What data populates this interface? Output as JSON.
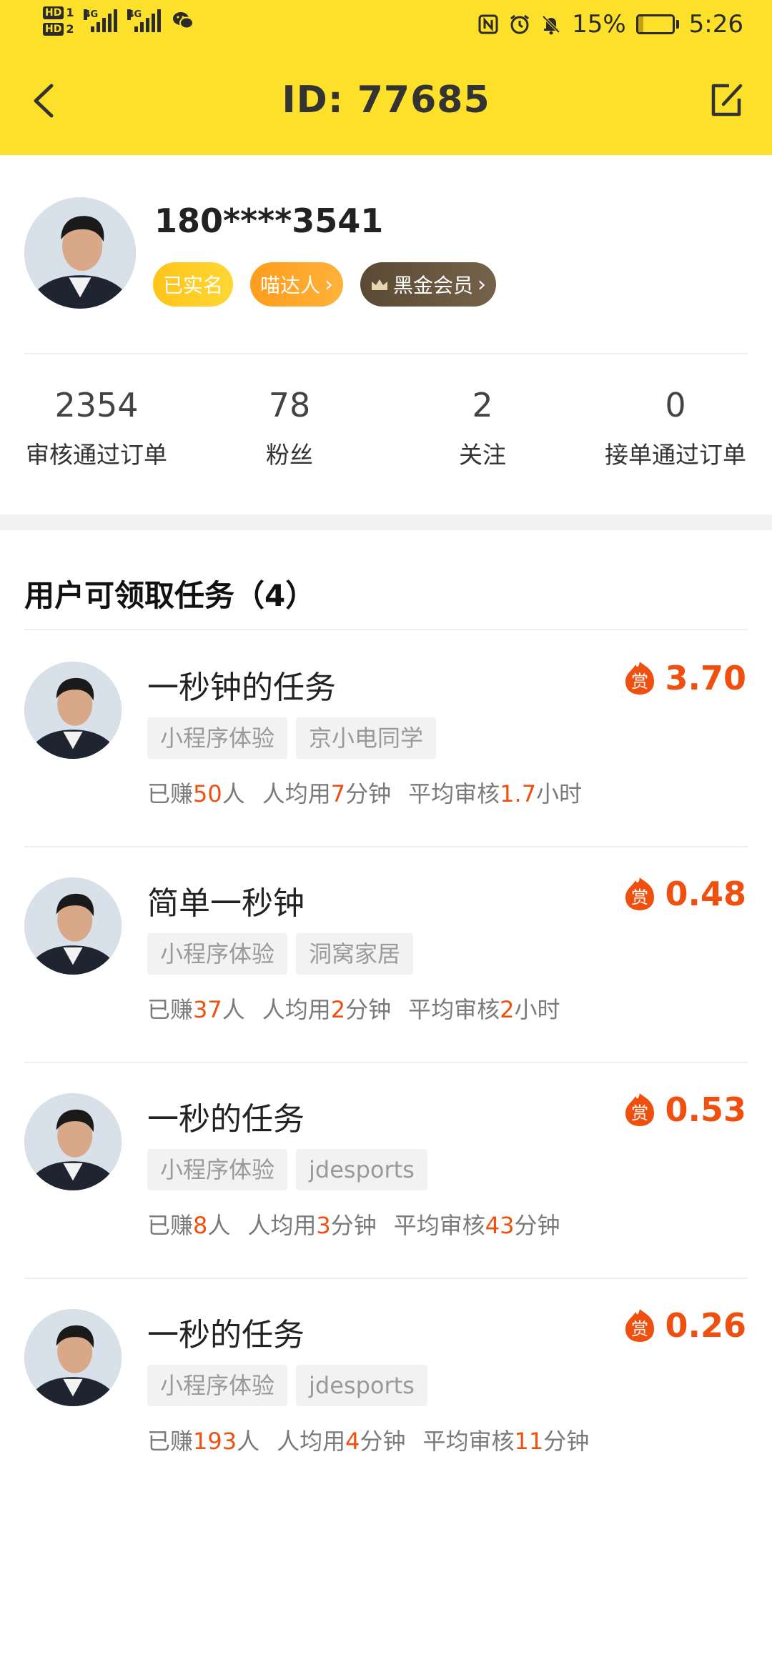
{
  "status_bar": {
    "sim1": "HD",
    "sim1_num": "1",
    "sim2": "HD",
    "sim2_num": "2",
    "net1": "4G",
    "net2": "4G",
    "battery_percent_text": "15%",
    "battery_level": 0.15,
    "time": "5:26"
  },
  "header": {
    "title": "ID:  77685"
  },
  "profile": {
    "phone": "180****3541",
    "badges": {
      "real_name": "已实名",
      "miaoda": "喵达人",
      "vip": "黑金会员"
    }
  },
  "stats": [
    {
      "value": "2354",
      "label": "审核通过订单"
    },
    {
      "value": "78",
      "label": "粉丝"
    },
    {
      "value": "2",
      "label": "关注"
    },
    {
      "value": "0",
      "label": "接单通过订单"
    }
  ],
  "section": {
    "title": "用户可领取任务（4）"
  },
  "reward_icon_char": "赏",
  "tasks": [
    {
      "title": "一秒钟的任务",
      "reward": "3.70",
      "tags": [
        "小程序体验",
        "京小电同学"
      ],
      "earned_prefix": "已赚",
      "earned": "50",
      "earned_suffix": "人",
      "avg_prefix": "人均用",
      "avg": "7",
      "avg_suffix": "分钟",
      "review_prefix": "平均审核",
      "review": "1.7",
      "review_suffix": "小时"
    },
    {
      "title": "简单一秒钟",
      "reward": "0.48",
      "tags": [
        "小程序体验",
        "洞窝家居"
      ],
      "earned_prefix": "已赚",
      "earned": "37",
      "earned_suffix": "人",
      "avg_prefix": "人均用",
      "avg": "2",
      "avg_suffix": "分钟",
      "review_prefix": "平均审核",
      "review": "2",
      "review_suffix": "小时"
    },
    {
      "title": "一秒的任务",
      "reward": "0.53",
      "tags": [
        "小程序体验",
        "jdesports"
      ],
      "earned_prefix": "已赚",
      "earned": "8",
      "earned_suffix": "人",
      "avg_prefix": "人均用",
      "avg": "3",
      "avg_suffix": "分钟",
      "review_prefix": "平均审核",
      "review": "43",
      "review_suffix": "分钟"
    },
    {
      "title": "一秒的任务",
      "reward": "0.26",
      "tags": [
        "小程序体验",
        "jdesports"
      ],
      "earned_prefix": "已赚",
      "earned": "193",
      "earned_suffix": "人",
      "avg_prefix": "人均用",
      "avg": "4",
      "avg_suffix": "分钟",
      "review_prefix": "平均审核",
      "review": "11",
      "review_suffix": "分钟"
    }
  ],
  "colors": {
    "header_bg": "#fde02a",
    "accent_orange": "#f0500f",
    "badge_gold": "#ffc31a",
    "badge_orange": "#ff9c1c",
    "badge_vip": "#5a4934"
  },
  "icons": {
    "back": "back-arrow-icon",
    "edit": "edit-icon",
    "reward": "reward-icon",
    "crown": "crown-icon"
  }
}
